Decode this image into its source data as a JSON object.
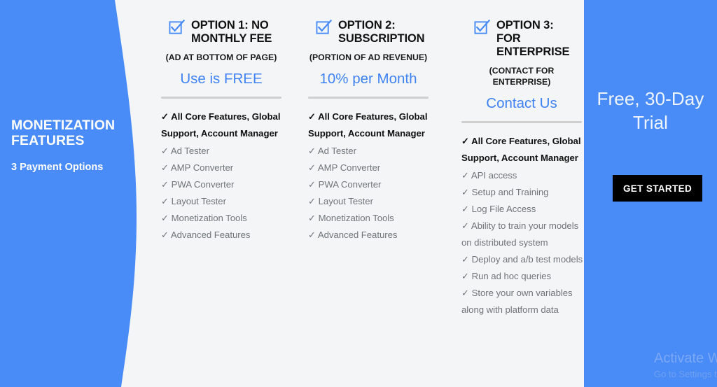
{
  "left_panel": {
    "title": "MONETIZATION FEATURES",
    "subtitle": "3 Payment Options",
    "background_color": "#4a8cf7"
  },
  "columns": [
    {
      "checkbox_icon": "checked-checkbox-icon",
      "title": "OPTION 1: NO MONTHLY FEE",
      "note": "(AD AT BOTTOM OF PAGE)",
      "price": "Use is FREE",
      "price_color": "#3f82f2",
      "features": [
        {
          "tick": "✓",
          "text": "All Core Features, Global Support, Account Manager",
          "emphasis": true
        },
        {
          "tick": "✓",
          "text": "Ad Tester",
          "emphasis": false
        },
        {
          "tick": "✓",
          "text": "AMP Converter",
          "emphasis": false
        },
        {
          "tick": "✓",
          "text": "PWA Converter",
          "emphasis": false
        },
        {
          "tick": "✓",
          "text": "Layout Tester",
          "emphasis": false
        },
        {
          "tick": "✓",
          "text": "Monetization Tools",
          "emphasis": false
        },
        {
          "tick": "✓",
          "text": "Advanced Features",
          "emphasis": false
        }
      ]
    },
    {
      "checkbox_icon": "checked-checkbox-icon",
      "title": "OPTION 2: SUBSCRIPTION",
      "note": "(PORTION OF AD REVENUE)",
      "price": "10% per Month",
      "price_color": "#3f82f2",
      "features": [
        {
          "tick": "✓",
          "text": "All Core Features, Global Support, Account Manager",
          "emphasis": true
        },
        {
          "tick": "✓",
          "text": "Ad Tester",
          "emphasis": false
        },
        {
          "tick": "✓",
          "text": "AMP Converter",
          "emphasis": false
        },
        {
          "tick": "✓",
          "text": "PWA Converter",
          "emphasis": false
        },
        {
          "tick": "✓",
          "text": "Layout Tester",
          "emphasis": false
        },
        {
          "tick": "✓",
          "text": "Monetization Tools",
          "emphasis": false
        },
        {
          "tick": "✓",
          "text": "Advanced Features",
          "emphasis": false
        }
      ]
    },
    {
      "checkbox_icon": "checked-checkbox-icon",
      "title": "OPTION 3: FOR ENTERPRISE",
      "note": "(CONTACT FOR ENTERPRISE)",
      "price": "Contact Us",
      "price_color": "#3f82f2",
      "features": [
        {
          "tick": "✓",
          "text": "All Core Features, Global Support, Account Manager",
          "emphasis": true
        },
        {
          "tick": "✓",
          "text": "API access",
          "emphasis": false
        },
        {
          "tick": "✓",
          "text": "Setup and Training",
          "emphasis": false
        },
        {
          "tick": "✓",
          "text": "Log File Access",
          "emphasis": false
        },
        {
          "tick": "✓",
          "text": "Ability to train your models on distributed system",
          "emphasis": false
        },
        {
          "tick": "✓",
          "text": "Deploy and a/b test models",
          "emphasis": false
        },
        {
          "tick": "✓",
          "text": "Run ad hoc queries",
          "emphasis": false
        },
        {
          "tick": "✓",
          "text": "Store your own variables along with platform data",
          "emphasis": false
        }
      ]
    }
  ],
  "right_panel": {
    "title": "Free, 30-Day Trial",
    "cta_label": "GET STARTED",
    "cta_background": "#000000",
    "background_color": "#4a8cf7"
  },
  "watermark": {
    "line1": "Activate Windows",
    "line2": "Go to Settings to activate Windows."
  }
}
